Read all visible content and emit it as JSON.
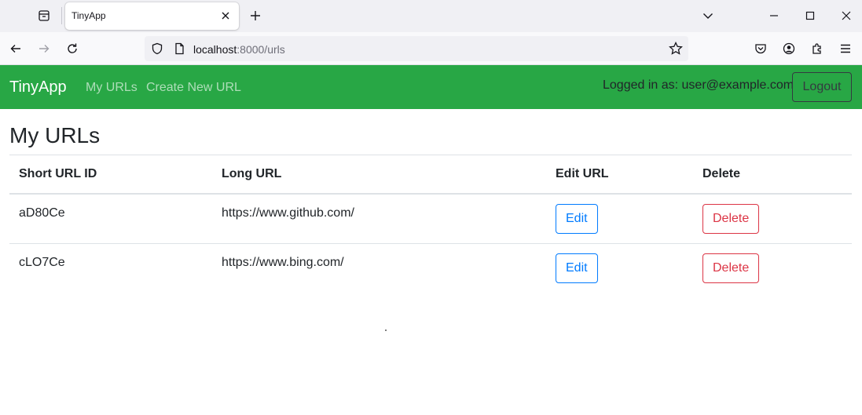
{
  "browser": {
    "tab_title": "TinyApp",
    "url_host": "localhost",
    "url_rest": ":8000/urls"
  },
  "app": {
    "brand": "TinyApp",
    "nav": {
      "my_urls": "My URLs",
      "create_new": "Create New URL"
    },
    "logged_in_text": "Logged in as: user@example.com",
    "logout_label": "Logout",
    "accent_color": "#28a745"
  },
  "page": {
    "title": "My URLs",
    "table": {
      "headers": [
        "Short URL ID",
        "Long URL",
        "Edit URL",
        "Delete"
      ],
      "rows": [
        {
          "short_id": "aD80Ce",
          "long_url": "https://www.github.com/",
          "edit_label": "Edit",
          "delete_label": "Delete"
        },
        {
          "short_id": "cLO7Ce",
          "long_url": "https://www.bing.com/",
          "edit_label": "Edit",
          "delete_label": "Delete"
        }
      ]
    }
  }
}
